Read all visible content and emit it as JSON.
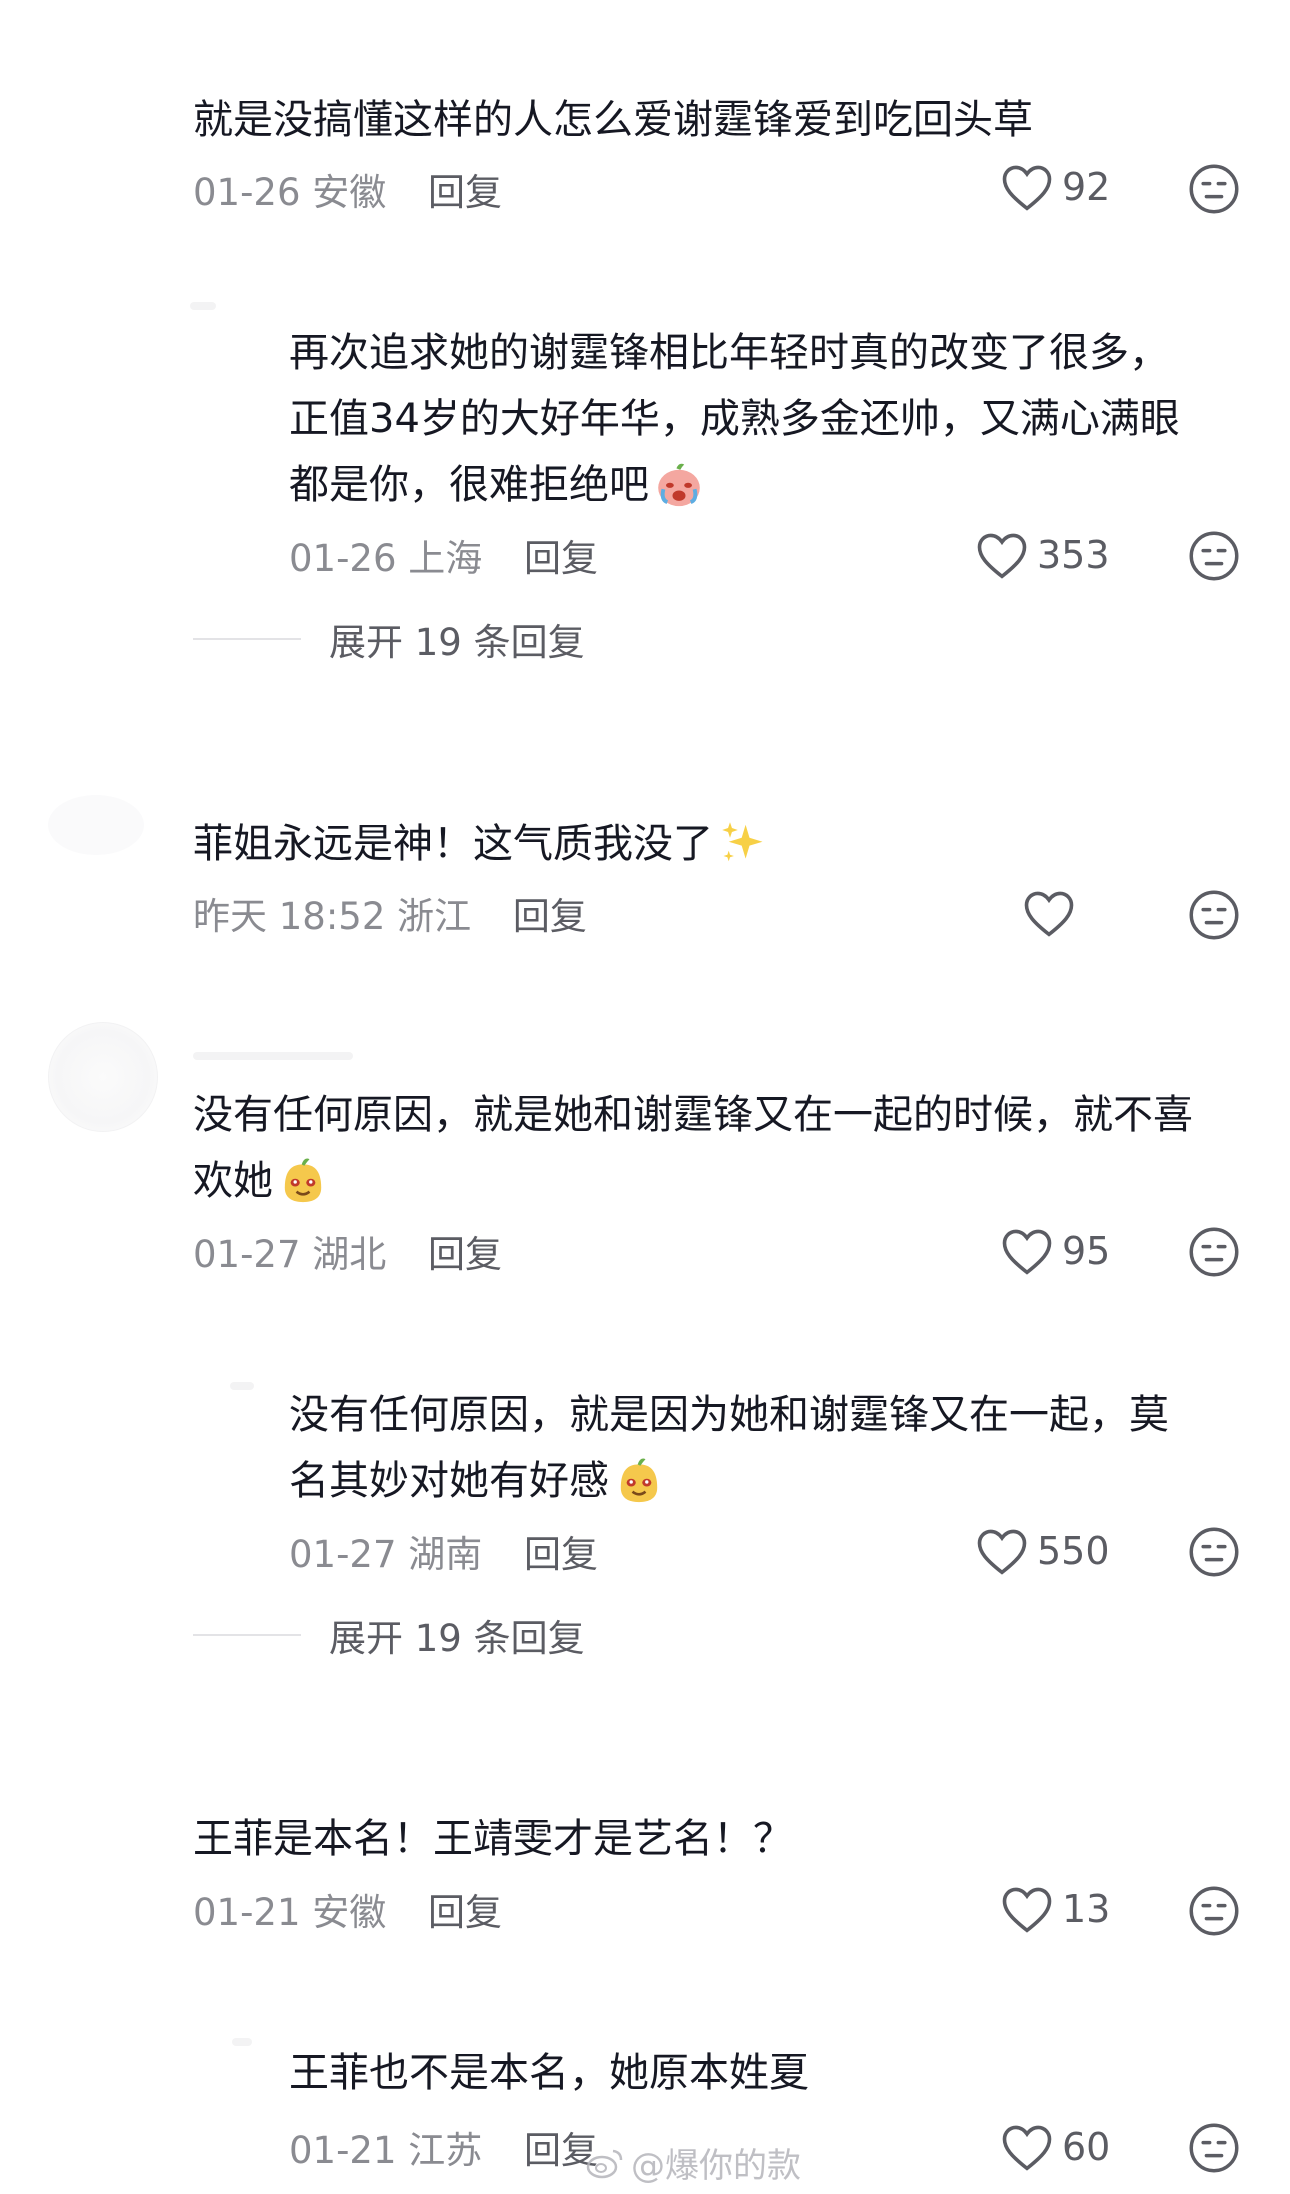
{
  "comments": [
    {
      "text": "就是没搞懂这样的人怎么爱谢霆锋爱到吃回头草",
      "date": "01-26",
      "location": "安徽",
      "reply_label": "回复",
      "likes": "92"
    },
    {
      "text": "再次追求她的谢霆锋相比年轻时真的改变了很多，\n正值34岁的大好年华，成熟多金还帅，又满心满眼\n都是你，很难拒绝吧",
      "emoji": "crying-face-emoji",
      "date": "01-26",
      "location": "上海",
      "reply_label": "回复",
      "likes": "353",
      "expand_label": "展开 19 条回复"
    },
    {
      "text": "菲姐永远是神！这气质我没了",
      "emoji": "sparkles-emoji",
      "date": "昨天 18:52",
      "location": "浙江",
      "reply_label": "回复",
      "likes": ""
    },
    {
      "text": "没有任何原因，就是她和谢霆锋又在一起的时候，就不喜\n欢她",
      "emoji": "smirk-emoji",
      "date": "01-27",
      "location": "湖北",
      "reply_label": "回复",
      "likes": "95"
    },
    {
      "text": "没有任何原因，就是因为她和谢霆锋又在一起，莫\n名其妙对她有好感",
      "emoji": "smirk-emoji",
      "date": "01-27",
      "location": "湖南",
      "reply_label": "回复",
      "likes": "550",
      "expand_label": "展开 19 条回复"
    },
    {
      "text": "王菲是本名！王靖雯才是艺名！？",
      "date": "01-21",
      "location": "安徽",
      "reply_label": "回复",
      "likes": "13"
    },
    {
      "text": "王菲也不是本名，她原本姓夏",
      "date": "01-21",
      "location": "江苏",
      "reply_label": "回复",
      "likes": "60"
    }
  ],
  "watermark": "@爆你的款",
  "colors": {
    "text": "#161823",
    "meta": "#8a8b91",
    "icon": "#5b5c63"
  }
}
